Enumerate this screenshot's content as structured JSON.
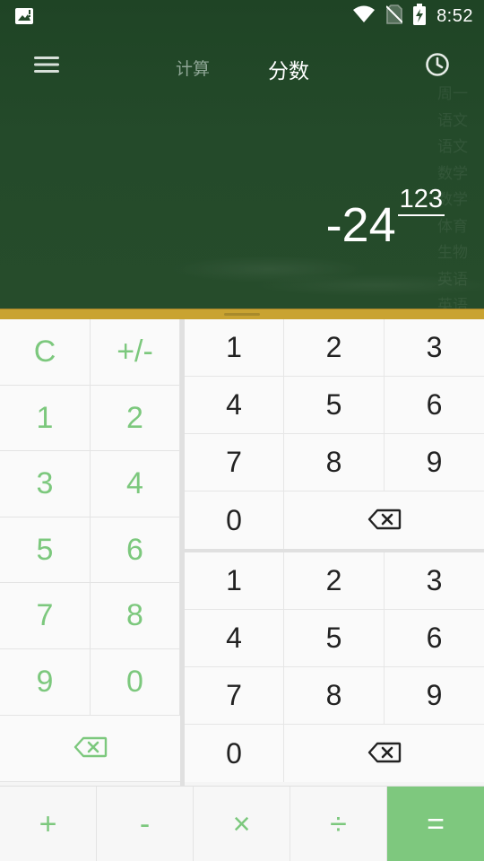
{
  "status": {
    "time": "8:52"
  },
  "tabs": [
    {
      "label": "计算",
      "active": false
    },
    {
      "label": "分数",
      "active": true
    }
  ],
  "watermark": [
    "周一",
    "语文",
    "语文",
    "数学",
    "数学",
    "体育",
    "生物",
    "英语",
    "英语"
  ],
  "display": {
    "integer": "-24",
    "numerator": "123"
  },
  "left_pad": {
    "keys": [
      "C",
      "+/-",
      "1",
      "2",
      "3",
      "4",
      "5",
      "6",
      "7",
      "8",
      "9",
      "0"
    ],
    "backspace": "backspace-icon"
  },
  "numerator_pad": {
    "keys": [
      "1",
      "2",
      "3",
      "4",
      "5",
      "6",
      "7",
      "8",
      "9",
      "0"
    ],
    "backspace": "backspace-icon"
  },
  "denominator_pad": {
    "keys": [
      "1",
      "2",
      "3",
      "4",
      "5",
      "6",
      "7",
      "8",
      "9",
      "0"
    ],
    "backspace": "backspace-icon"
  },
  "operators": [
    "+",
    "-",
    "×",
    "÷",
    "="
  ],
  "colors": {
    "accent": "#7ec87e",
    "board": "#244a2a",
    "divider": "#c9a331"
  }
}
